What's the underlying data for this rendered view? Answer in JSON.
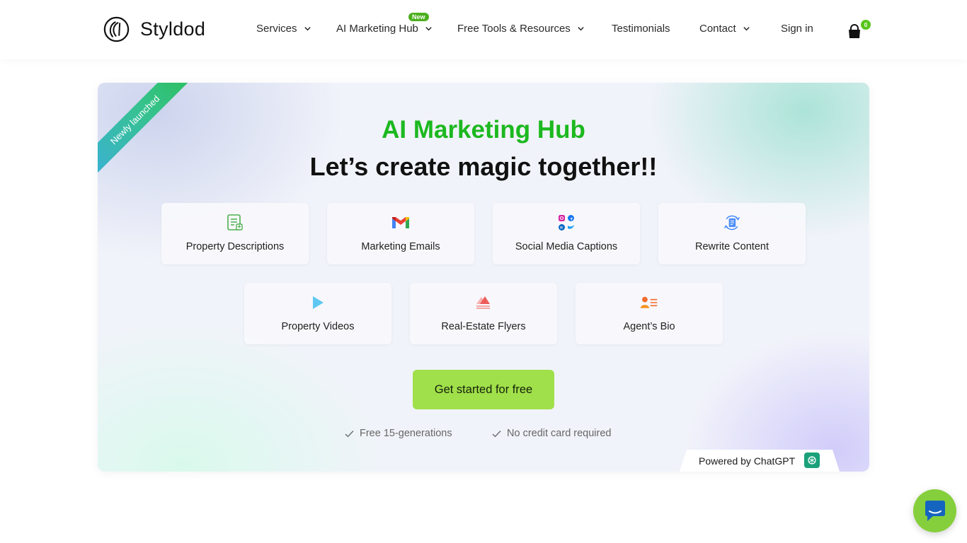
{
  "brand": {
    "name": "Styldod",
    "logo_icon": "styldod-logo-icon"
  },
  "nav": {
    "services": "Services",
    "ai_hub": "AI Marketing Hub",
    "new_badge": "New",
    "free_tools": "Free Tools & Resources",
    "testimonials": "Testimonials",
    "contact": "Contact",
    "sign_in": "Sign in",
    "cart_count": "0"
  },
  "hero": {
    "ribbon": "Newly launched",
    "title": "AI Marketing Hub",
    "subtitle": "Let’s create magic together!!",
    "tools": [
      {
        "label": "Property Descriptions",
        "icon": "document-icon"
      },
      {
        "label": "Marketing Emails",
        "icon": "gmail-icon"
      },
      {
        "label": "Social Media Captions",
        "icon": "social-media-icon"
      },
      {
        "label": "Rewrite Content",
        "icon": "rewrite-icon"
      },
      {
        "label": "Property Videos",
        "icon": "play-icon"
      },
      {
        "label": "Real-Estate Flyers",
        "icon": "flyer-icon"
      },
      {
        "label": "Agent’s Bio",
        "icon": "agent-bio-icon"
      }
    ],
    "cta": "Get started for free",
    "perks": [
      "Free 15-generations",
      "No credit card required"
    ],
    "powered_by": "Powered by ChatGPT"
  },
  "colors": {
    "accent_green": "#1cb81f",
    "cta_green": "#a0e04a",
    "chat_green": "#86cf3c"
  }
}
